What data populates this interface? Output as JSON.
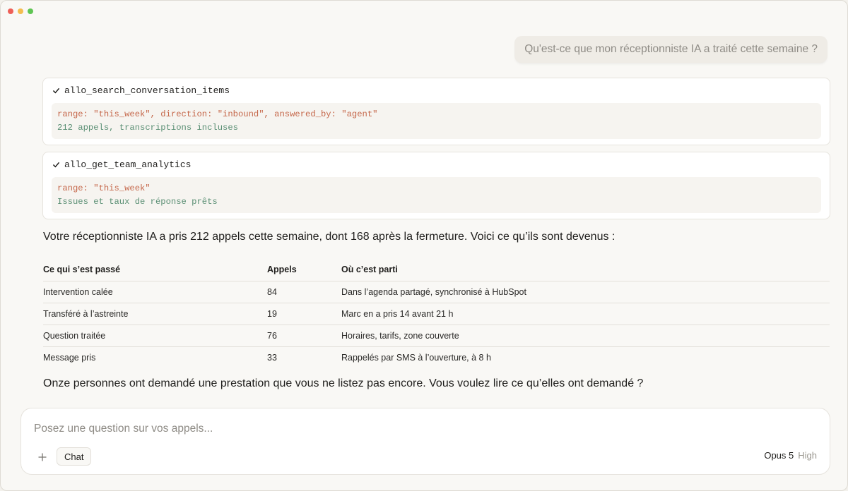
{
  "conversation": {
    "user_message": "Qu'est-ce que mon réceptionniste IA a traité cette semaine ?",
    "tool_calls": [
      {
        "name": "allo_search_conversation_items",
        "args": "range: \"this_week\", direction: \"inbound\", answered_by: \"agent\"",
        "result": "212 appels, transcriptions incluses"
      },
      {
        "name": "allo_get_team_analytics",
        "args": "range: \"this_week\"",
        "result": "Issues et taux de réponse prêts"
      }
    ],
    "answer_intro": "Votre réceptionniste IA a pris 212 appels cette semaine, dont 168 après la fermeture. Voici ce qu’ils sont devenus :",
    "table": {
      "headers": [
        "Ce qui s’est passé",
        "Appels",
        "Où c’est parti"
      ],
      "rows": [
        [
          "Intervention calée",
          "84",
          "Dans l’agenda partagé, synchronisé à HubSpot"
        ],
        [
          "Transféré à l’astreinte",
          "19",
          "Marc en a pris 14 avant 21 h"
        ],
        [
          "Question traitée",
          "76",
          "Horaires, tarifs, zone couverte"
        ],
        [
          "Message pris",
          "33",
          "Rappelés par SMS à l’ouverture, à 8 h"
        ]
      ]
    },
    "answer_outro": "Onze personnes ont demandé une prestation que vous ne listez pas encore. Vous voulez lire ce qu’elles ont demandé ?"
  },
  "composer": {
    "placeholder": "Posez une question sur vos appels...",
    "plus_icon": "plus-icon",
    "mode_label": "Chat",
    "model_name": "Opus 5",
    "model_effort": "High"
  },
  "colors": {
    "args": "#c5674a",
    "result": "#5a8f74",
    "highlight_value": "#5a8f74"
  }
}
